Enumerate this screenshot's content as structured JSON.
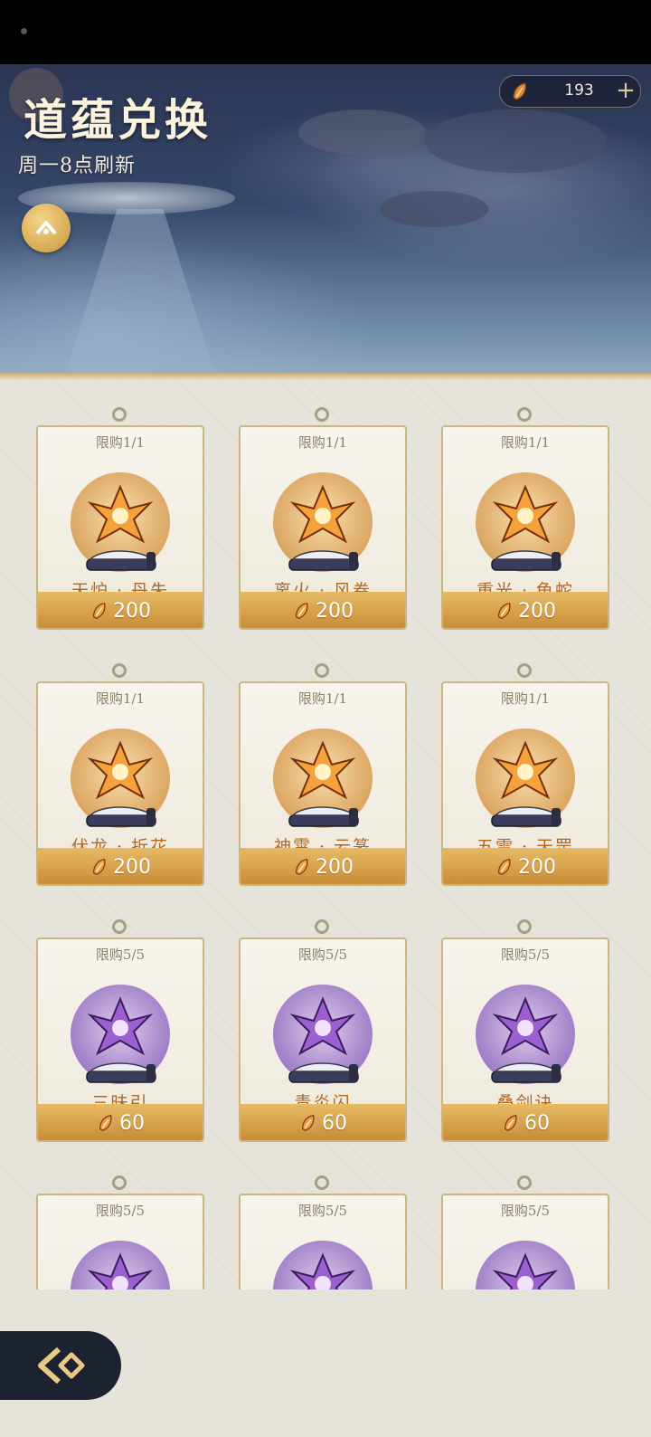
{
  "header": {
    "title": "道蕴兑换",
    "subtitle": "周一8点刷新",
    "currency_amount": "193",
    "plus_label": "+"
  },
  "items": [
    {
      "limit": "限购1/1",
      "name": "天炉 · 丹朱",
      "price": "200",
      "theme": "gold"
    },
    {
      "limit": "限购1/1",
      "name": "离火 · 风卷",
      "price": "200",
      "theme": "gold"
    },
    {
      "limit": "限购1/1",
      "name": "重光 · 龟蛇",
      "price": "200",
      "theme": "gold"
    },
    {
      "limit": "限购1/1",
      "name": "伏龙 · 折花",
      "price": "200",
      "theme": "gold"
    },
    {
      "limit": "限购1/1",
      "name": "神霄 · 云篆",
      "price": "200",
      "theme": "gold"
    },
    {
      "limit": "限购1/1",
      "name": "五雷 · 天罡",
      "price": "200",
      "theme": "gold"
    },
    {
      "limit": "限购5/5",
      "name": "三昧引",
      "price": "60",
      "theme": "purple"
    },
    {
      "limit": "限购5/5",
      "name": "青炎闪",
      "price": "60",
      "theme": "purple"
    },
    {
      "limit": "限购5/5",
      "name": "叠剑诀",
      "price": "60",
      "theme": "purple"
    },
    {
      "limit": "限购5/5",
      "name": "",
      "price": "",
      "theme": "purple"
    },
    {
      "limit": "限购5/5",
      "name": "",
      "price": "",
      "theme": "purple"
    },
    {
      "limit": "限购5/5",
      "name": "",
      "price": "",
      "theme": "purple"
    }
  ],
  "colors": {
    "accent_gold": "#d9a15c",
    "name_text": "#b26722",
    "price_bar": "#c78b34",
    "background": "#e6e4da"
  },
  "icons": {
    "currency": "feather-crystal-icon",
    "up": "up-chevron-icon",
    "back": "back-arrow-icon"
  }
}
